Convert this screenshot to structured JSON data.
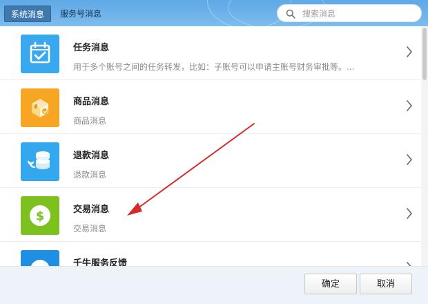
{
  "header": {
    "tabs": [
      {
        "label": "系统消息",
        "active": true
      },
      {
        "label": "服务号消息",
        "active": false
      }
    ],
    "search": {
      "placeholder": "搜索消息",
      "value": ""
    }
  },
  "messages": [
    {
      "title": "任务消息",
      "desc": "用于多个账号之间的任务转发，比如：子账号可以申请主账号财务审批等。...",
      "icon": "calendar-check-icon",
      "icon_color": "#3aa8ef"
    },
    {
      "title": "商品消息",
      "desc": "商品消息",
      "icon": "box-icon",
      "icon_color": "#f6a623"
    },
    {
      "title": "退款消息",
      "desc": "退款消息",
      "icon": "refund-coins-icon",
      "icon_color": "#34a8ee"
    },
    {
      "title": "交易消息",
      "desc": "交易消息",
      "icon": "dollar-icon",
      "icon_color": "#7cc11e"
    },
    {
      "title": "千牛服务反馈",
      "desc": "",
      "icon": "feedback-icon",
      "icon_color": "#1e8fe2"
    }
  ],
  "footer": {
    "confirm_label": "确定",
    "cancel_label": "取消"
  },
  "colors": {
    "header_bg": "#6fb3ea",
    "tab_active_bg": "#3f78ad",
    "annotation_arrow": "#d42a2a"
  }
}
